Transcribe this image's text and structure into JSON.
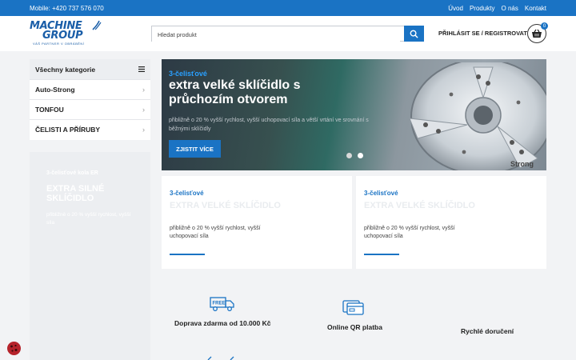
{
  "topbar": {
    "phone": "Mobile: +420 737 576 070",
    "nav": [
      "Úvod",
      "Produkty",
      "O nás",
      "Kontakt"
    ]
  },
  "logo": {
    "line1": "MACHINE",
    "line2": "GROUP",
    "tagline": "VÁŠ PARTNER V OBRÁBĚNÍ"
  },
  "search": {
    "placeholder": "Hledat produkt"
  },
  "account": {
    "login_label": "PŘIHLÁSIT SE / REGISTROVAT"
  },
  "cart": {
    "count": "0"
  },
  "categories": {
    "header": "Všechny kategorie",
    "items": [
      "Auto-Strong",
      "TONFOU",
      "ČELISTI A PŘÍRUBY"
    ]
  },
  "side_promo": {
    "kicker": "3-čelisťové kola ER",
    "title": "EXTRA SILNÉ SKLÍČIDLO",
    "desc": "přibližně o 20 % vyšší rychlost, vyšší síla"
  },
  "hero": {
    "kicker": "3-čelisťové",
    "title": "extra velké sklíčidlo s průchozím otvorem",
    "desc": "přibližně o 20 % vyšší rychlost, vyšší uchopovací síla a větší vrtání ve srovnání s běžnými sklíčidly",
    "cta": "ZJISTIT VÍCE",
    "slides": 2,
    "active_slide": 2,
    "product_label": "Strong"
  },
  "promos": [
    {
      "kicker": "3-čelisťové",
      "title": "EXTRA VELKÉ SKLÍČIDLO",
      "desc": "přibližně o 20 % vyšší rychlost, vyšší uchopovací síla"
    },
    {
      "kicker": "3-čelisťové",
      "title": "EXTRA VELKÉ SKLÍČIDLO",
      "desc": "přibližně o 20 % vyšší rychlost, vyšší uchopovací síla"
    }
  ],
  "features": {
    "free_badge": "FREE",
    "shipping": "Doprava zdarma od 10.000 Kč",
    "qr": "Online QR platba",
    "delivery": "Rychlé doručení"
  },
  "colors": {
    "primary": "#1a73c4",
    "topbar": "#1a73c4",
    "background": "#f2f3f5"
  }
}
